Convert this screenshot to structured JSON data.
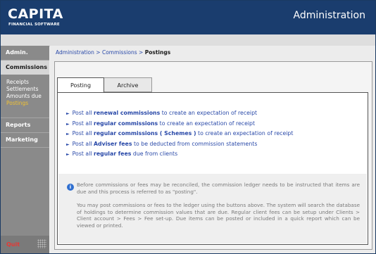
{
  "header": {
    "logo_main": "CAPITA",
    "logo_sub": "FINANCIAL SOFTWARE",
    "app_title": "Administration"
  },
  "sidebar": {
    "items": [
      {
        "label": "Admin."
      },
      {
        "label": "Commissions",
        "active": true
      },
      {
        "label": "Reports"
      },
      {
        "label": "Marketing"
      }
    ],
    "sub_items": [
      {
        "label": "Receipts"
      },
      {
        "label": "Settlements"
      },
      {
        "label": "Amounts due"
      },
      {
        "label": "Postings",
        "current": true
      }
    ],
    "quit_label": "Quit"
  },
  "breadcrumb": {
    "part1": "Administration",
    "part2": "Commissions",
    "current": "Postings",
    "separator": ">"
  },
  "tabs": [
    {
      "label": "Posting",
      "active": true
    },
    {
      "label": "Archive"
    }
  ],
  "links": [
    {
      "prefix": "Post all ",
      "bold": "renewal commissions",
      "suffix": " to create an expectation of receipt"
    },
    {
      "prefix": "Post all ",
      "bold": "regular commissions",
      "suffix": " to create an expectation of receipt"
    },
    {
      "prefix": "Post all ",
      "bold": "regular commissions ( Schemes )",
      "suffix": " to create an expectation of receipt"
    },
    {
      "prefix": "Post all ",
      "bold": "Adviser fees",
      "suffix": " to be deducted from commission statements"
    },
    {
      "prefix": "Post all ",
      "bold": "regular fees",
      "suffix": " due from clients"
    }
  ],
  "info": {
    "icon": "info-icon",
    "paragraph1": "Before commissions or fees may be reconciled, the commission ledger needs to be instructed that items are due and this process is referred to as \"posting\".",
    "paragraph2": "You may post commissions or fees to the ledger using the buttons above. The system will search the database of holdings to determine commission values that are due. Regular client fees can be setup under Clients > Client account > Fees > Fee set-up. Due items can be posted or included in a quick report which can be viewed or printed."
  },
  "colors": {
    "header_bg": "#1a3d6e",
    "sidebar_bg": "#8a8a8a",
    "link": "#2848a8",
    "current_sub": "#f1c232",
    "quit": "#e53935"
  }
}
